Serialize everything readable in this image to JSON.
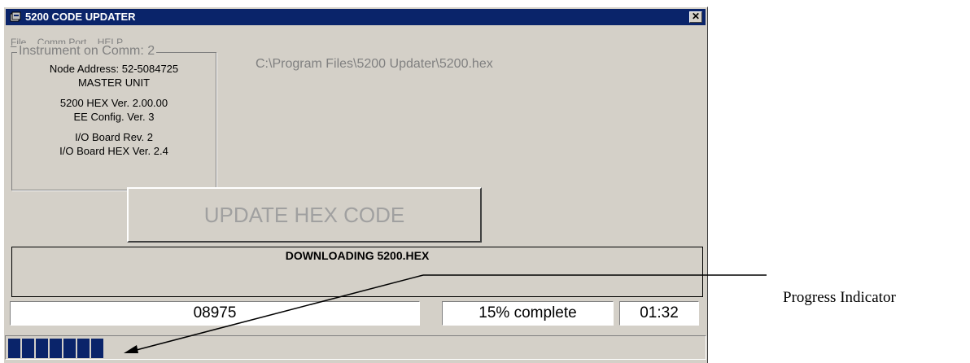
{
  "window": {
    "title": "5200 CODE UPDATER",
    "close_glyph": "✕"
  },
  "menu": [
    {
      "label": "File"
    },
    {
      "label": "Comm Port"
    },
    {
      "label": "HELP"
    }
  ],
  "instrument": {
    "legend": "Instrument on Comm: 2",
    "node_address": "Node Address: 52-5084725",
    "unit_type": "MASTER UNIT",
    "hex_version": "5200 HEX Ver. 2.00.00",
    "ee_config": "EE Config. Ver.  3",
    "io_board_rev": "I/O Board Rev. 2",
    "io_board_hex": "I/O Board HEX Ver. 2.4"
  },
  "file_path": "C:\\Program Files\\5200 Updater\\5200.hex",
  "update_button": {
    "label": "UPDATE HEX CODE",
    "enabled": false
  },
  "status": {
    "message": "DOWNLOADING 5200.HEX",
    "counter": "08975",
    "percent_text": "15% complete",
    "elapsed": "01:32"
  },
  "progress": {
    "blocks_filled": 7,
    "fraction": 0.15,
    "color": "#0a246a"
  },
  "annotation": {
    "label": "Progress Indicator"
  },
  "colors": {
    "titlebar": "#0a246a",
    "window_bg": "#d4d0c8",
    "disabled_text": "#808080"
  }
}
